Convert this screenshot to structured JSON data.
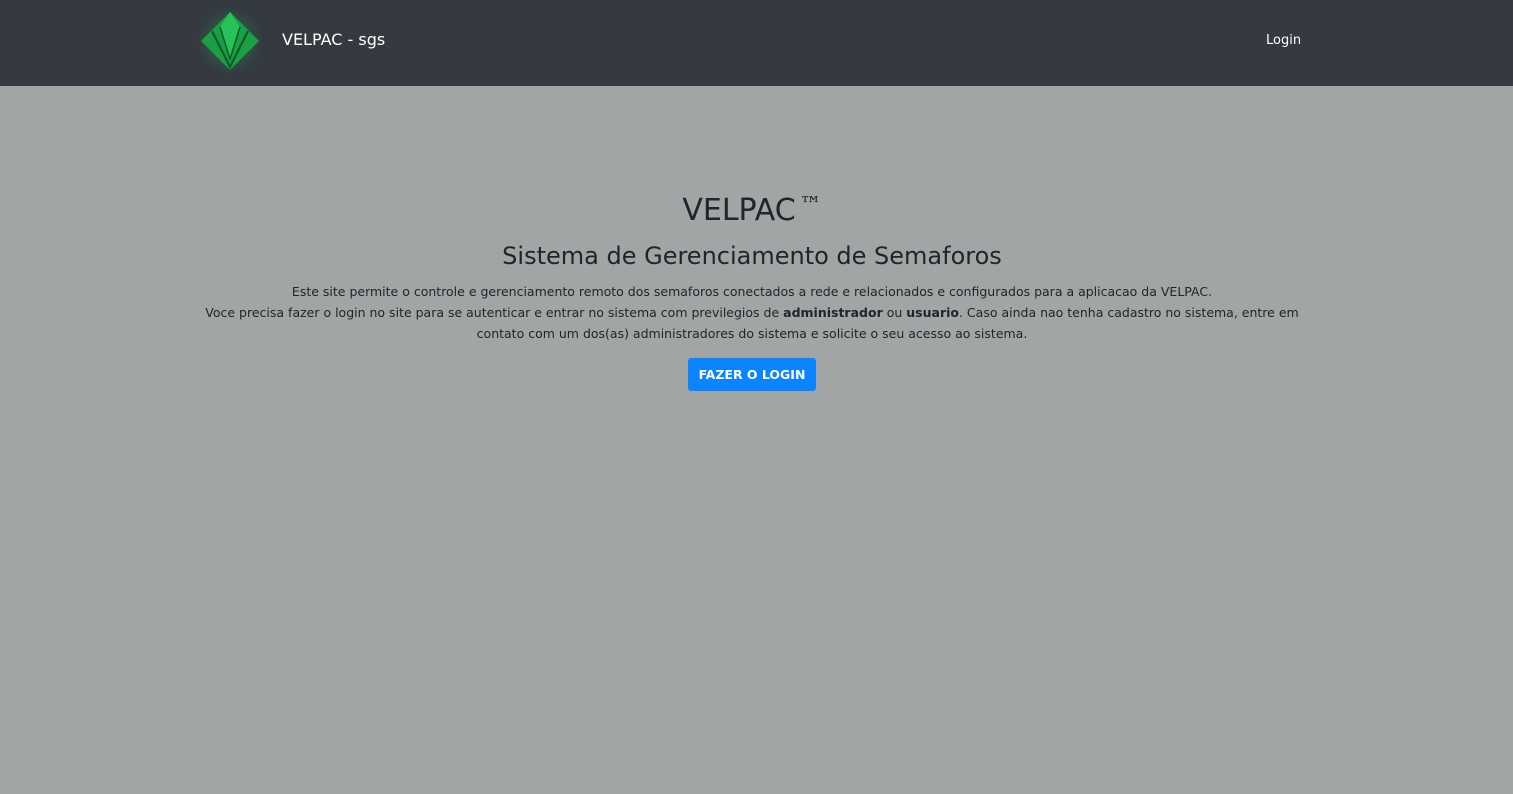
{
  "navbar": {
    "brand_name": "VELPAC - sgs",
    "login_link": "Login",
    "background_color": "#343a40",
    "logo_icon": "velpac-v-diamond-logo",
    "logo_color": "#1fa34a"
  },
  "hero": {
    "title": "VELPAC",
    "trademark": "™",
    "subtitle": "Sistema de Gerenciamento de Semaforos",
    "description_line1": "Este site permite o controle e gerenciamento remoto dos semaforos conectados a rede e relacionados e configurados para a aplicacao da VELPAC.",
    "description_part1": "Voce precisa fazer o login no site para se autenticar e entrar no sistema com previlegios de ",
    "role_admin": "administrador",
    "description_or": " ou ",
    "role_user": "usuario",
    "description_part2": ". Caso ainda nao tenha cadastro no sistema, entre em contato com um dos(as) administradores do sistema e solicite o seu acesso ao sistema.",
    "cta_label": "FAZER O LOGIN",
    "cta_color": "#0a84ff"
  },
  "page": {
    "background_color": "#a2a5a5"
  }
}
